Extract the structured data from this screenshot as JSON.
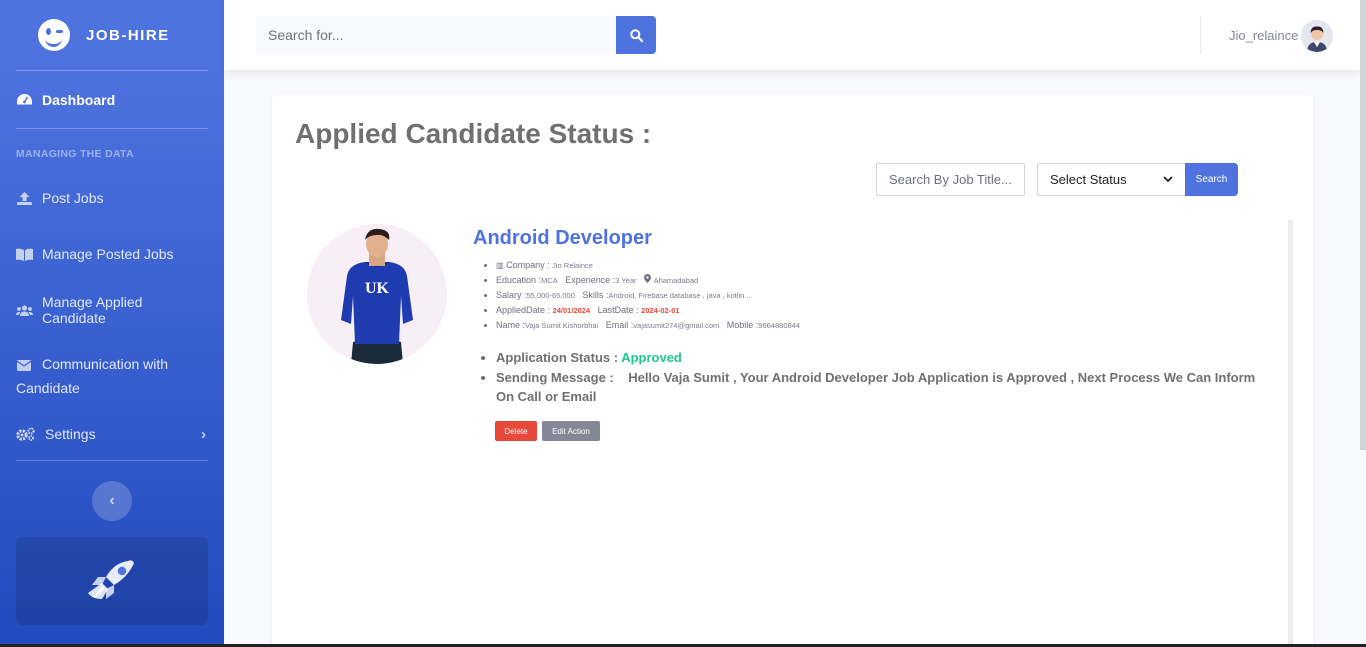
{
  "brand": {
    "name": "JOB-HIRE"
  },
  "sidebar": {
    "dashboard": "Dashboard",
    "heading": "MANAGING THE DATA",
    "items": [
      {
        "label": "Post Jobs",
        "icon": "upload-icon"
      },
      {
        "label": "Manage Posted Jobs",
        "icon": "book-icon"
      },
      {
        "label": "Manage Applied Candidate",
        "icon": "users-icon"
      },
      {
        "label": "Communication with Candidate",
        "icon": "envelope-icon"
      },
      {
        "label": "Settings",
        "icon": "cogs-icon"
      }
    ],
    "toggle_icon": "chevron-left-icon",
    "promo_icon": "rocket-icon"
  },
  "topbar": {
    "search_placeholder": "Search for...",
    "username": "Jio_relaince"
  },
  "page": {
    "title": "Applied Candidate Status :",
    "filter_placeholder": "Search By Job Title...",
    "status_select": "Select Status",
    "search_btn": "Search"
  },
  "candidate": {
    "job_title": "Android Developer",
    "company_label": "Company :",
    "company": "Jio Relaince",
    "education_label": "Education :",
    "education": "MCA",
    "experience_label": "Experience :",
    "experience": "3 Year",
    "location": "Ahamadabad",
    "salary_label": "Salary :",
    "salary": "55,000-65,000",
    "skills_label": "Skills :",
    "skills": "Android, Firebase database , java , kotlin ...",
    "applied_label": "AppliedDate :",
    "applied_date": "24/01/2024",
    "last_label": "LastDate :",
    "last_date": "2024-02-01",
    "name_label": "Name :",
    "name": "Vaja Sumit Kishorbhai",
    "email_label": "Email :",
    "email": "vajasumit274@gmail.com",
    "mobile_label": "Mobile :",
    "mobile": "9664880844",
    "status_label": "Application Status :",
    "status": "Approved",
    "message_label": "Sending Message :",
    "message": "Hello Vaja Sumit , Your Android Developer Job Application is Approved , Next Process We Can Inform On Call or Email",
    "delete_btn": "Delete",
    "edit_btn": "Edit Action"
  },
  "colors": {
    "primary": "#4e73df",
    "success": "#1cc88a",
    "danger": "#e74a3b",
    "secondary": "#858796"
  }
}
